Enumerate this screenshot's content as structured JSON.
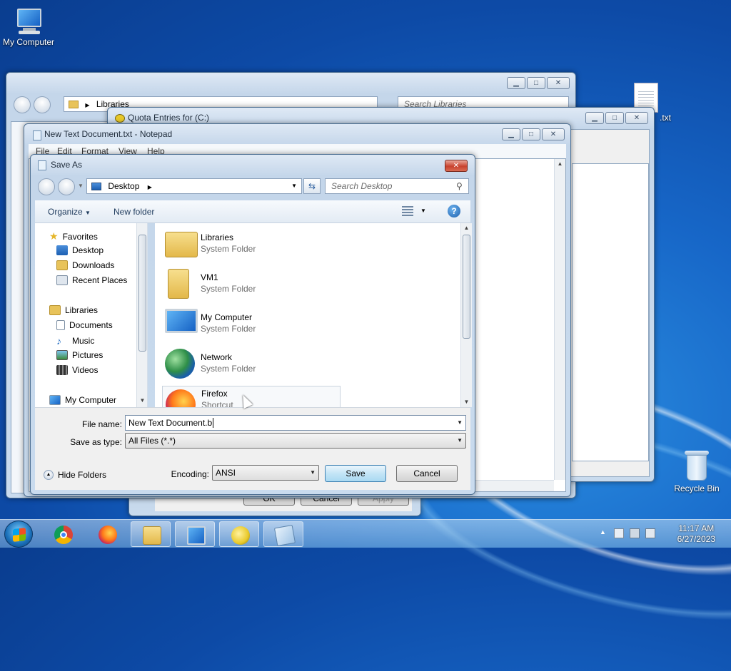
{
  "desktop": {
    "icons": [
      {
        "label": "My Computer"
      },
      {
        "label": ".txt"
      },
      {
        "label": "Recycle Bin"
      }
    ]
  },
  "explorer": {
    "address": "Libraries",
    "search_placeholder": "Search Libraries"
  },
  "quota": {
    "title": "Quota Entries for  (C:)"
  },
  "notepad": {
    "title": "New Text Document.txt - Notepad",
    "menu": [
      "File",
      "Edit",
      "Format",
      "View",
      "Help"
    ]
  },
  "properties": {
    "buttons": [
      "OK",
      "Cancel",
      "Apply"
    ]
  },
  "saveas": {
    "title": "Save As",
    "location": "Desktop",
    "search_placeholder": "Search Desktop",
    "toolbar": {
      "organize": "Organize",
      "new_folder": "New folder"
    },
    "nav": {
      "favorites": "Favorites",
      "favorites_items": [
        "Desktop",
        "Downloads",
        "Recent Places"
      ],
      "libraries": "Libraries",
      "libraries_items": [
        "Documents",
        "Music",
        "Pictures",
        "Videos"
      ],
      "my_computer": "My Computer"
    },
    "files": [
      {
        "name": "Libraries",
        "type": "System Folder"
      },
      {
        "name": "VM1",
        "type": "System Folder"
      },
      {
        "name": "My Computer",
        "type": "System Folder"
      },
      {
        "name": "Network",
        "type": "System Folder"
      },
      {
        "name": "Firefox",
        "type": "Shortcut"
      }
    ],
    "file_name_label": "File name:",
    "file_name_value": "New Text Document.b",
    "save_type_label": "Save as type:",
    "save_type_value": "All Files  (*.*)",
    "hide_folders": "Hide Folders",
    "encoding_label": "Encoding:",
    "encoding_value": "ANSI",
    "save_button": "Save",
    "cancel_button": "Cancel"
  },
  "taskbar": {
    "time": "11:17 AM",
    "date": "6/27/2023"
  },
  "colors": {
    "desktop": "#1767c8",
    "accent": "#3c7fb1",
    "close_red": "#c8432f"
  }
}
